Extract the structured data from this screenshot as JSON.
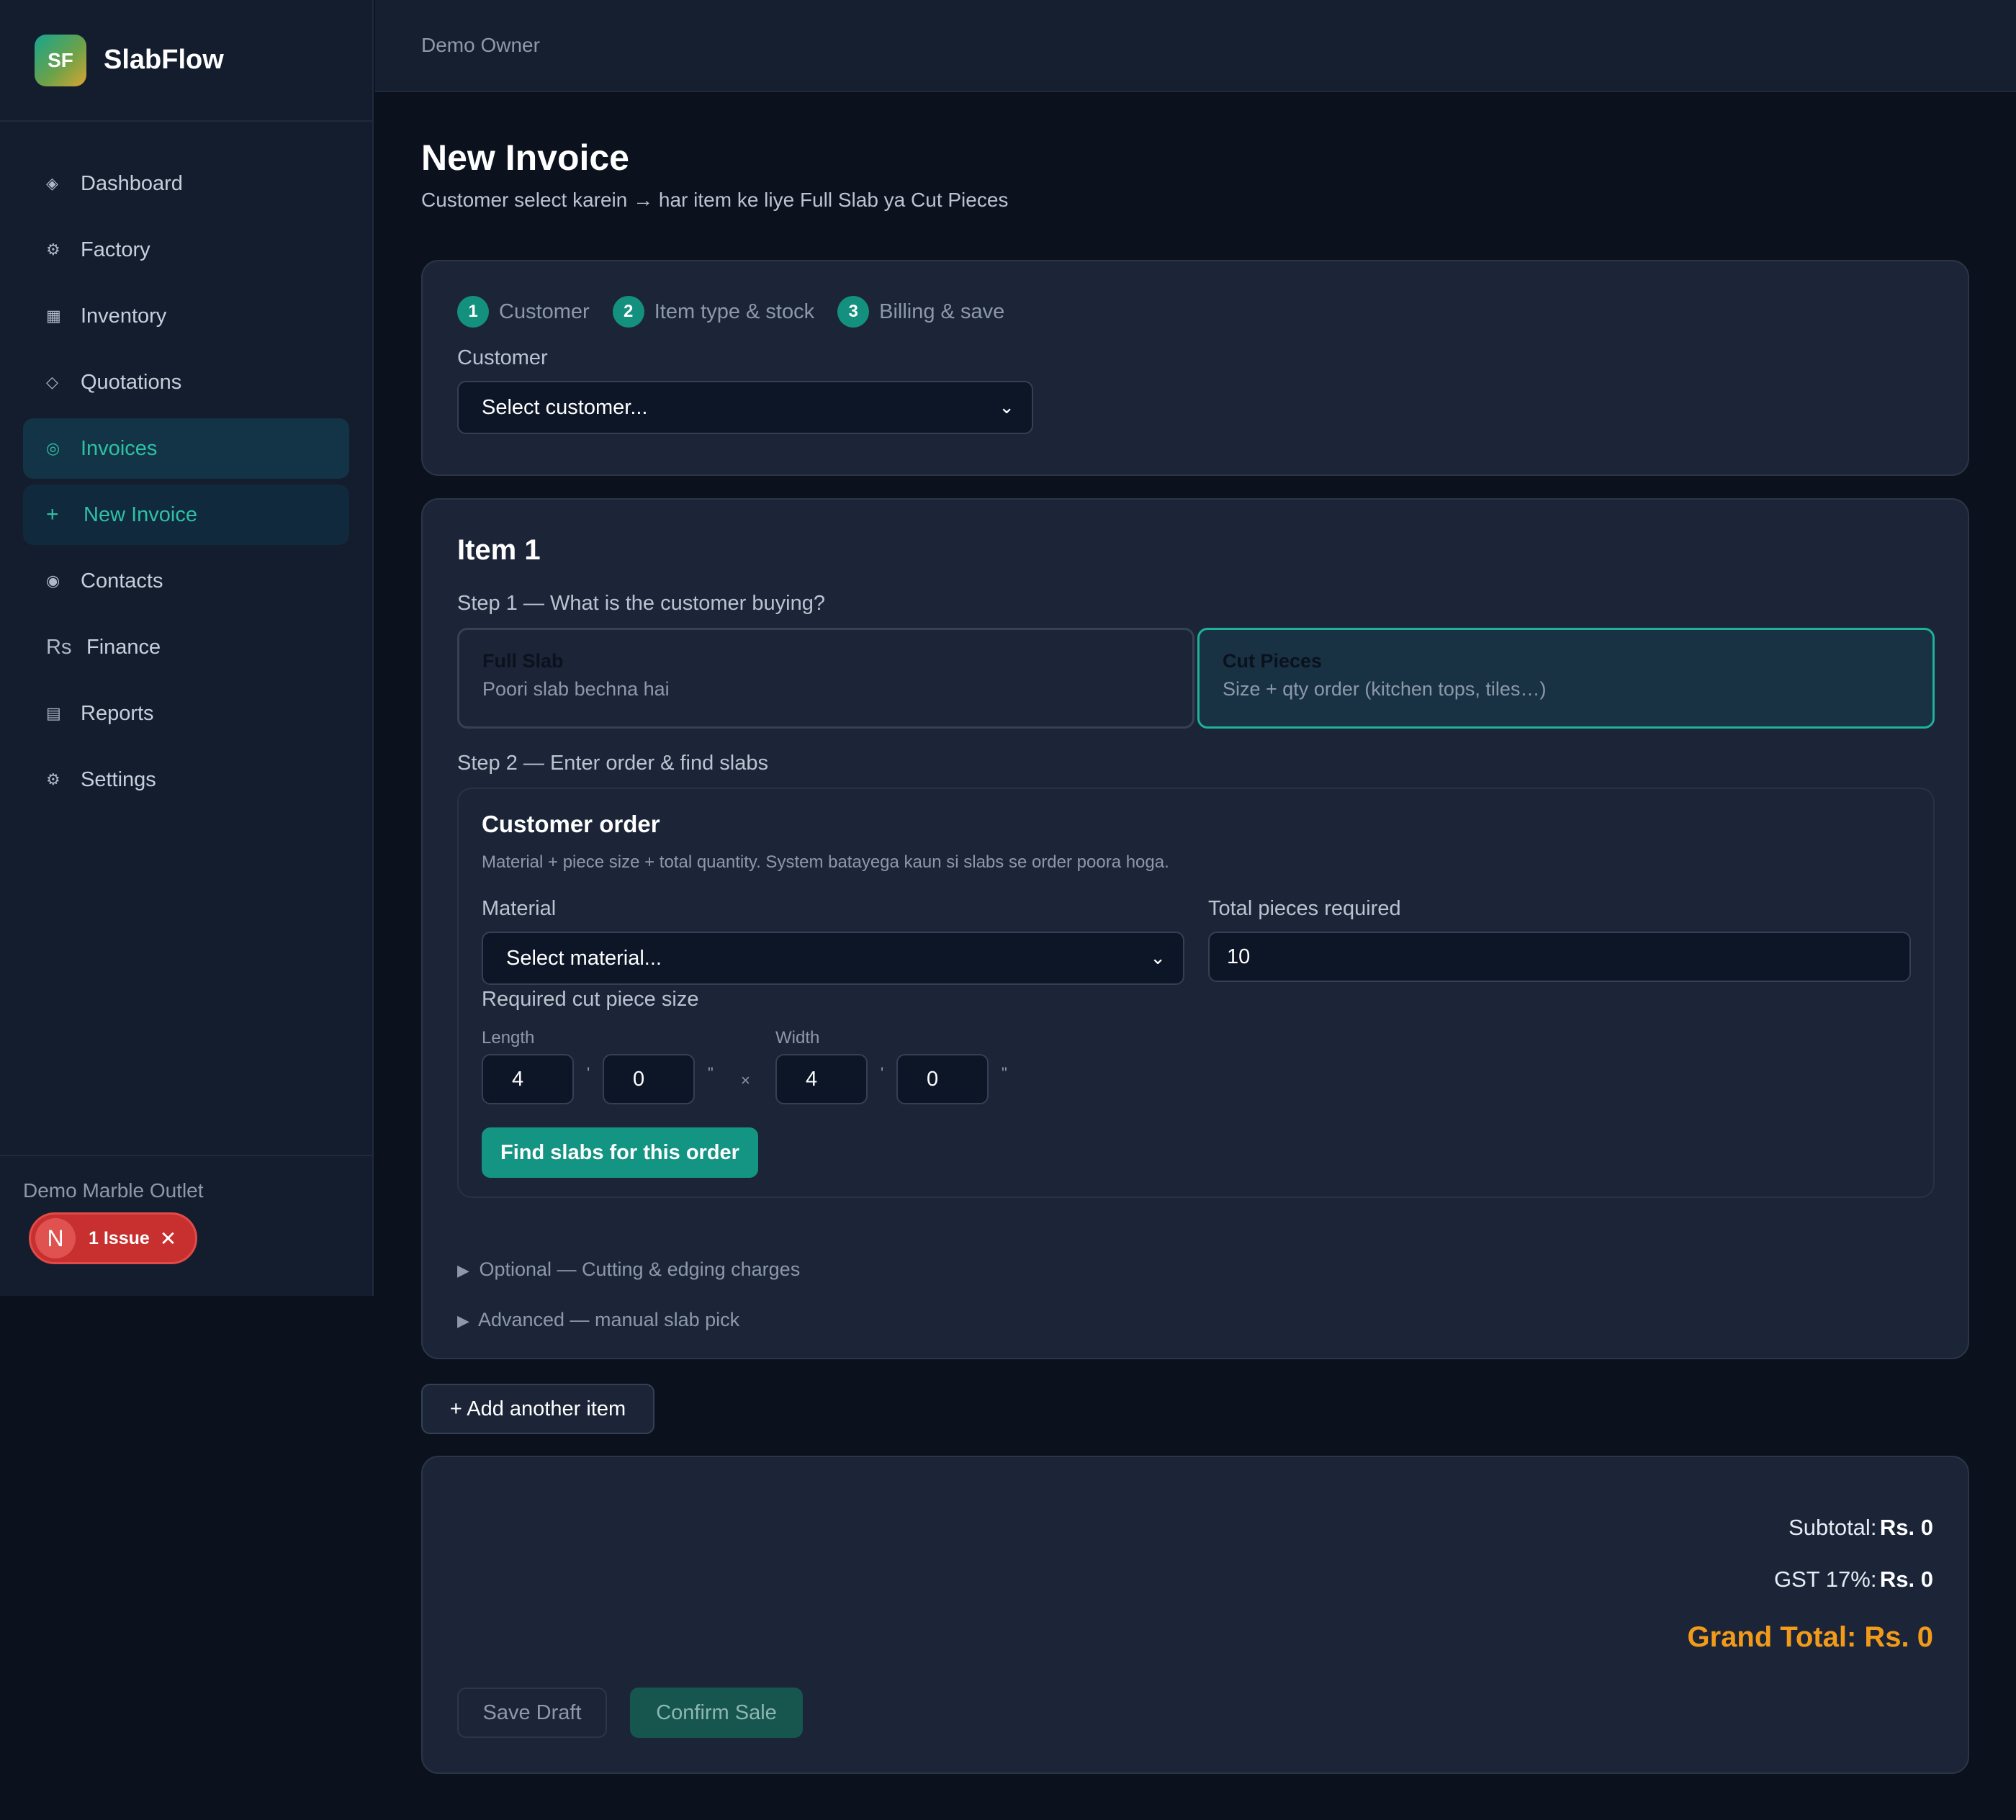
{
  "app": {
    "logo_text": "SF",
    "name": "SlabFlow"
  },
  "topbar": {
    "user": "Demo Owner"
  },
  "sidebar": {
    "items": [
      {
        "label": "Dashboard",
        "icon": "◈"
      },
      {
        "label": "Factory",
        "icon": "⚙"
      },
      {
        "label": "Inventory",
        "icon": "▦"
      },
      {
        "label": "Quotations",
        "icon": "◇"
      },
      {
        "label": "Invoices",
        "icon": "◎",
        "active": true
      },
      {
        "label": "New Invoice",
        "icon": "+",
        "active": true
      },
      {
        "label": "Contacts",
        "icon": "◉"
      },
      {
        "label": "Finance",
        "icon": "Rs"
      },
      {
        "label": "Reports",
        "icon": "▤"
      },
      {
        "label": "Settings",
        "icon": "⚙"
      }
    ],
    "footer": {
      "org": "Demo Marble Outlet",
      "issue_avatar": "N",
      "issue_label": "1 Issue",
      "issue_close": "✕"
    }
  },
  "page": {
    "title": "New Invoice",
    "subtitle": "Customer select karein → har item ke liye Full Slab ya Cut Pieces"
  },
  "steps": [
    {
      "num": "1",
      "label": "Customer"
    },
    {
      "num": "2",
      "label": "Item type & stock"
    },
    {
      "num": "3",
      "label": "Billing & save"
    }
  ],
  "customer": {
    "label": "Customer",
    "selected": "Select customer..."
  },
  "item": {
    "title": "Item 1",
    "step1_label": "Step 1 — What is the customer buying?",
    "full_slab": {
      "title": "Full Slab",
      "subtitle": "Poori slab bechna hai"
    },
    "cut_pieces": {
      "title": "Cut Pieces",
      "subtitle": "Size + qty order (kitchen tops, tiles…)",
      "selected": true
    },
    "step2_label": "Step 2 — Enter order & find slabs",
    "order": {
      "title": "Customer order",
      "description": "Material + piece size + total quantity. System batayega kaun si slabs se order poora hoga.",
      "material_label": "Material",
      "material_selected": "Select material...",
      "total_label": "Total pieces required",
      "total_value": "10",
      "size_label": "Required cut piece size",
      "length_label": "Length",
      "width_label": "Width",
      "length_ft": "4",
      "length_in": "0",
      "width_ft": "4",
      "width_in": "0",
      "feet_mark": "'",
      "inch_mark": "\"",
      "times": "×",
      "find_button": "Find slabs for this order"
    },
    "optional_label": "Optional — Cutting & edging charges",
    "advanced_label": "Advanced — manual slab pick",
    "disclosure_icon": "▶"
  },
  "add_item_button": "+ Add another item",
  "billing": {
    "subtotal_label": "Subtotal:",
    "subtotal_value": "Rs. 0",
    "gst_label": "GST 17%:",
    "gst_value": "Rs. 0",
    "grand_total": "Grand Total: Rs. 0",
    "save_draft": "Save Draft",
    "confirm_sale": "Confirm Sale"
  },
  "colors": {
    "accent": "#149482",
    "accent_text": "#2fc0a5",
    "grand_total": "#f29a1a",
    "danger": "#c8302f",
    "background": "#0b111d",
    "card": "#1b2537"
  },
  "icons": {
    "chevron": "chevron-down-icon"
  }
}
